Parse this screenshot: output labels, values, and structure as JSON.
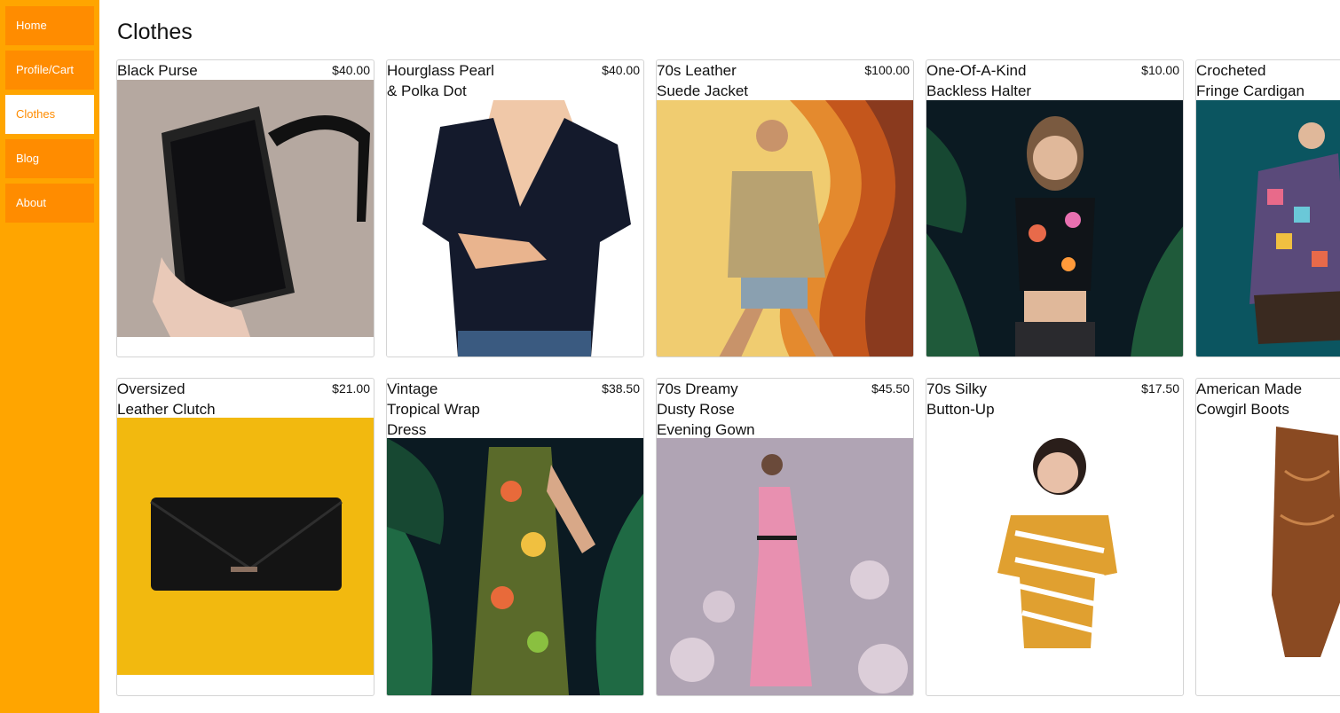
{
  "nav": {
    "items": [
      {
        "label": "Home"
      },
      {
        "label": "Profile/Cart"
      },
      {
        "label": "Clothes"
      },
      {
        "label": "Blog"
      },
      {
        "label": "About"
      }
    ],
    "active": "Clothes"
  },
  "page": {
    "title": "Clothes"
  },
  "colors": {
    "sidebar": "#ffa500",
    "nav_button": "#ff8c00",
    "nav_active_bg": "#ffffff"
  },
  "products": [
    {
      "name": "Black Purse",
      "price": "$40.00"
    },
    {
      "name": "Hourglass Pearl\n& Polka Dot",
      "price": "$40.00"
    },
    {
      "name": "70s Leather\nSuede Jacket",
      "price": "$100.00"
    },
    {
      "name": "One-Of-A-Kind\nBackless Halter",
      "price": "$10.00"
    },
    {
      "name": "Crocheted\nFringe Cardigan",
      "price": ""
    },
    {
      "name": "Oversized\nLeather Clutch",
      "price": "$21.00"
    },
    {
      "name": "Vintage\nTropical Wrap\nDress",
      "price": "$38.50"
    },
    {
      "name": "70s Dreamy\nDusty Rose\nEvening Gown",
      "price": "$45.50"
    },
    {
      "name": "70s Silky\nButton-Up",
      "price": "$17.50"
    },
    {
      "name": "American Made\nCowgirl Boots",
      "price": ""
    }
  ]
}
